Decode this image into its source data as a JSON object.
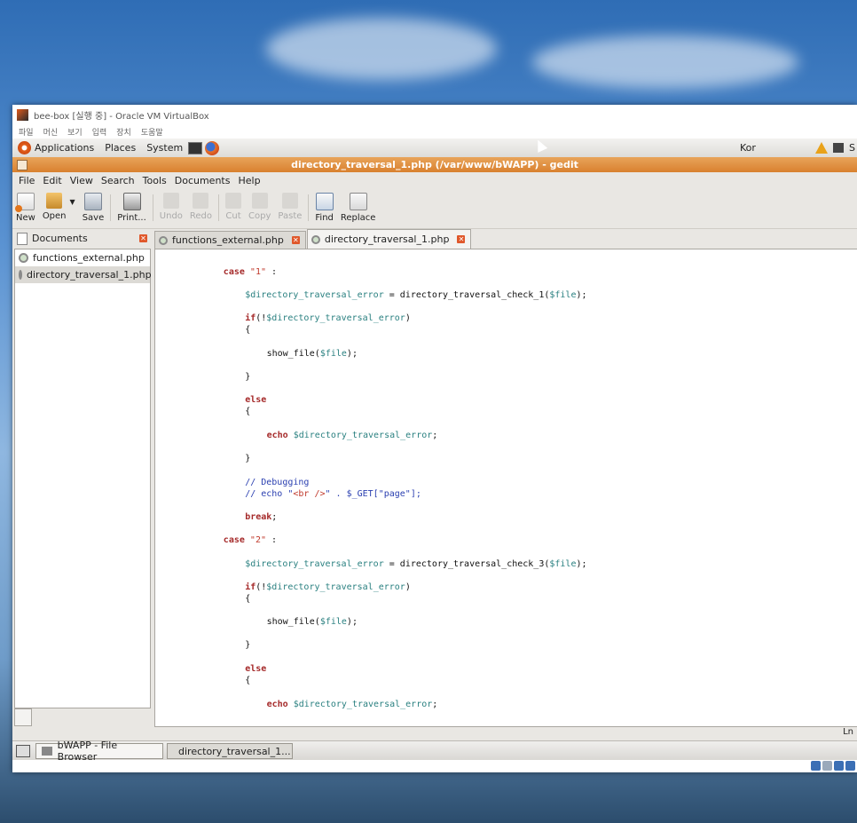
{
  "vbox": {
    "title": "bee-box [실행 중] - Oracle VM VirtualBox",
    "menu": [
      "파일",
      "머신",
      "보기",
      "입력",
      "장치",
      "도움말"
    ]
  },
  "panel": {
    "applications": "Applications",
    "places": "Places",
    "system": "System",
    "keyboard": "Kor",
    "right_label": "S"
  },
  "gedit": {
    "title": "directory_traversal_1.php (/var/www/bWAPP) - gedit",
    "menu": [
      "File",
      "Edit",
      "View",
      "Search",
      "Tools",
      "Documents",
      "Help"
    ],
    "toolbar": {
      "new": "New",
      "open": "Open",
      "save": "Save",
      "print": "Print...",
      "undo": "Undo",
      "redo": "Redo",
      "cut": "Cut",
      "copy": "Copy",
      "paste": "Paste",
      "find": "Find",
      "replace": "Replace"
    },
    "side_panel": {
      "title": "Documents",
      "items": [
        "functions_external.php",
        "directory_traversal_1.php"
      ]
    },
    "tabs": [
      "functions_external.php",
      "directory_traversal_1.php"
    ],
    "status": {
      "ln": "Ln"
    }
  },
  "code_lines": [
    {
      "indent": "        ",
      "parts": [
        [
          "kw",
          "case"
        ],
        [
          "txt",
          " "
        ],
        [
          "str",
          "\"1\""
        ],
        [
          "txt",
          " :"
        ]
      ]
    },
    {
      "indent": "            ",
      "parts": [
        [
          "var",
          "$directory_traversal_error"
        ],
        [
          "txt",
          " = directory_traversal_check_1("
        ],
        [
          "var",
          "$file"
        ],
        [
          "txt",
          ");"
        ]
      ]
    },
    {
      "indent": "            ",
      "parts": [
        [
          "kw",
          "if"
        ],
        [
          "txt",
          "(!"
        ],
        [
          "var",
          "$directory_traversal_error"
        ],
        [
          "txt",
          ")"
        ]
      ]
    },
    {
      "indent": "            ",
      "parts": [
        [
          "txt",
          "{"
        ]
      ]
    },
    {
      "indent": "                ",
      "parts": [
        [
          "txt",
          "show_file("
        ],
        [
          "var",
          "$file"
        ],
        [
          "txt",
          ");"
        ]
      ]
    },
    {
      "indent": "            ",
      "parts": [
        [
          "txt",
          "}"
        ]
      ]
    },
    {
      "indent": "            ",
      "parts": [
        [
          "kw",
          "else"
        ]
      ]
    },
    {
      "indent": "            ",
      "parts": [
        [
          "txt",
          "{"
        ]
      ]
    },
    {
      "indent": "                ",
      "parts": [
        [
          "kw",
          "echo"
        ],
        [
          "txt",
          " "
        ],
        [
          "var",
          "$directory_traversal_error"
        ],
        [
          "txt",
          ";"
        ]
      ]
    },
    {
      "indent": "            ",
      "parts": [
        [
          "txt",
          "}"
        ]
      ]
    },
    {
      "indent": "            ",
      "parts": [
        [
          "cm",
          "// Debugging"
        ]
      ]
    },
    {
      "indent": "            ",
      "parts": [
        [
          "cm",
          "// echo \""
        ],
        [
          "str",
          "<br />"
        ],
        [
          "cm",
          "\" . $_GET[\"page\"];"
        ]
      ]
    },
    {
      "indent": "            ",
      "parts": [
        [
          "kw",
          "break"
        ],
        [
          "txt",
          ";"
        ]
      ]
    },
    {
      "indent": "        ",
      "parts": [
        [
          "kw",
          "case"
        ],
        [
          "txt",
          " "
        ],
        [
          "str",
          "\"2\""
        ],
        [
          "txt",
          " :"
        ]
      ]
    },
    {
      "indent": "            ",
      "parts": [
        [
          "var",
          "$directory_traversal_error"
        ],
        [
          "txt",
          " = directory_traversal_check_3("
        ],
        [
          "var",
          "$file"
        ],
        [
          "txt",
          ");"
        ]
      ]
    },
    {
      "indent": "            ",
      "parts": [
        [
          "kw",
          "if"
        ],
        [
          "txt",
          "(!"
        ],
        [
          "var",
          "$directory_traversal_error"
        ],
        [
          "txt",
          ")"
        ]
      ]
    },
    {
      "indent": "            ",
      "parts": [
        [
          "txt",
          "{"
        ]
      ]
    },
    {
      "indent": "                ",
      "parts": [
        [
          "txt",
          "show_file("
        ],
        [
          "var",
          "$file"
        ],
        [
          "txt",
          ");"
        ]
      ]
    },
    {
      "indent": "            ",
      "parts": [
        [
          "txt",
          "}"
        ]
      ]
    },
    {
      "indent": "            ",
      "parts": [
        [
          "kw",
          "else"
        ]
      ]
    },
    {
      "indent": "            ",
      "parts": [
        [
          "txt",
          "{"
        ]
      ]
    },
    {
      "indent": "                ",
      "parts": [
        [
          "kw",
          "echo"
        ],
        [
          "txt",
          " "
        ],
        [
          "var",
          "$directory_traversal_error"
        ],
        [
          "txt",
          ";"
        ]
      ]
    }
  ],
  "taskbar": {
    "items": [
      "bWAPP - File Browser",
      "directory_traversal_1..."
    ]
  }
}
